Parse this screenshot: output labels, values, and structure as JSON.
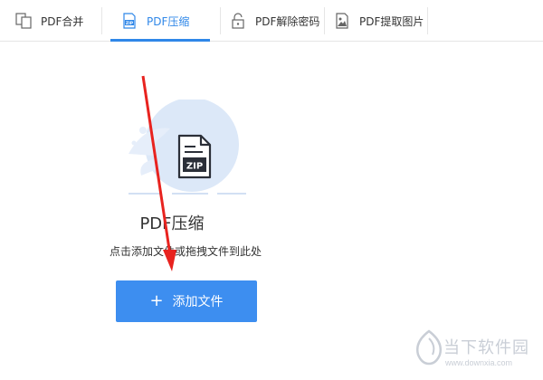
{
  "tabs": [
    {
      "label": "PDF合并",
      "icon": "merge-icon",
      "active": false
    },
    {
      "label": "PDF压缩",
      "icon": "zip-icon",
      "active": true
    },
    {
      "label": "PDF解除密码",
      "icon": "unlock-icon",
      "active": false
    },
    {
      "label": "PDF提取图片",
      "icon": "image-icon",
      "active": false
    }
  ],
  "main": {
    "illustration_label": "ZIP",
    "title": "PDF压缩",
    "hint": "点击添加文件或拖拽文件到此处",
    "add_button_label": "添加文件"
  },
  "watermark": {
    "text": "当下软件园",
    "url": "www.downxia.com"
  },
  "colors": {
    "accent": "#2f87e8",
    "button": "#3d8ef0",
    "arrow": "#e8231f",
    "illustration_circle": "#dce8f8"
  }
}
